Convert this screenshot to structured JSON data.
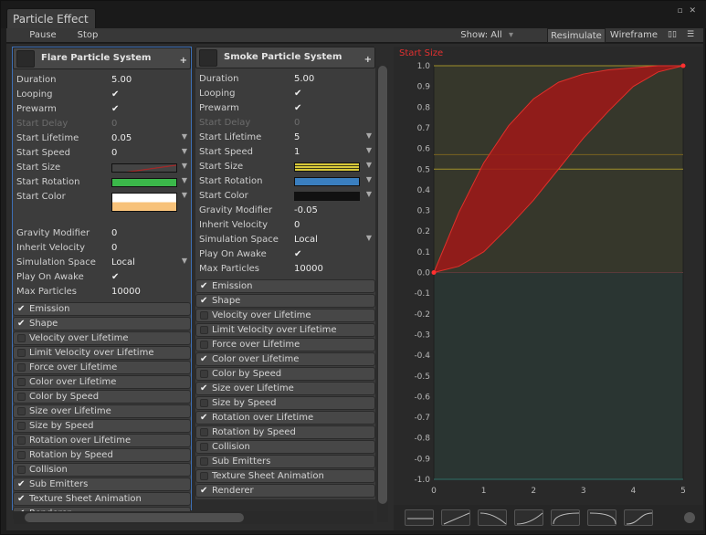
{
  "window": {
    "title": "Particle Effect"
  },
  "toolbar": {
    "pause": "Pause",
    "stop": "Stop",
    "show": "Show: All",
    "resimulate": "Resimulate",
    "wireframe": "Wireframe"
  },
  "panels": [
    {
      "title": "Flare Particle System",
      "props": [
        {
          "label": "Duration",
          "value": "5.00"
        },
        {
          "label": "Looping",
          "check": true
        },
        {
          "label": "Prewarm",
          "check": true
        },
        {
          "label": "Start Delay",
          "value": "0",
          "disabled": true
        },
        {
          "label": "Start Lifetime",
          "value": "0.05",
          "arrow": true
        },
        {
          "label": "Start Speed",
          "value": "0",
          "arrow": true
        },
        {
          "label": "Start Size",
          "curve": true,
          "arrow": true
        },
        {
          "label": "Start Rotation",
          "color": "#3bb84a",
          "arrow": true
        },
        {
          "label": "Start Color",
          "gradient": [
            "#ffffff",
            "#f7c27a"
          ],
          "arrow": true
        },
        {
          "gap": true
        },
        {
          "label": "Gravity Modifier",
          "value": "0"
        },
        {
          "label": "Inherit Velocity",
          "value": "0"
        },
        {
          "label": "Simulation Space",
          "value": "Local",
          "arrow": true
        },
        {
          "label": "Play On Awake",
          "check": true
        },
        {
          "label": "Max Particles",
          "value": "10000"
        }
      ],
      "modules": [
        {
          "label": "Emission",
          "on": true
        },
        {
          "label": "Shape",
          "on": true
        },
        {
          "label": "Velocity over Lifetime"
        },
        {
          "label": "Limit Velocity over Lifetime"
        },
        {
          "label": "Force over Lifetime"
        },
        {
          "label": "Color over Lifetime"
        },
        {
          "label": "Color by Speed"
        },
        {
          "label": "Size over Lifetime"
        },
        {
          "label": "Size by Speed"
        },
        {
          "label": "Rotation over Lifetime"
        },
        {
          "label": "Rotation by Speed"
        },
        {
          "label": "Collision"
        },
        {
          "label": "Sub Emitters",
          "on": true
        },
        {
          "label": "Texture Sheet Animation",
          "on": true
        },
        {
          "label": "Renderer",
          "on": true
        }
      ]
    },
    {
      "title": "Smoke Particle System",
      "props": [
        {
          "label": "Duration",
          "value": "5.00"
        },
        {
          "label": "Looping",
          "check": true
        },
        {
          "label": "Prewarm",
          "check": true
        },
        {
          "label": "Start Delay",
          "value": "0",
          "disabled": true
        },
        {
          "label": "Start Lifetime",
          "value": "5",
          "arrow": true
        },
        {
          "label": "Start Speed",
          "value": "1",
          "arrow": true
        },
        {
          "label": "Start Size",
          "color": "#d8c93a",
          "arrow": true
        },
        {
          "label": "Start Rotation",
          "color": "#3a7fc0",
          "arrow": true
        },
        {
          "label": "Start Color",
          "color": "#111111",
          "arrow": true
        },
        {
          "label": "Gravity Modifier",
          "value": "-0.05"
        },
        {
          "label": "Inherit Velocity",
          "value": "0"
        },
        {
          "label": "Simulation Space",
          "value": "Local",
          "arrow": true
        },
        {
          "label": "Play On Awake",
          "check": true
        },
        {
          "label": "Max Particles",
          "value": "10000"
        }
      ],
      "modules": [
        {
          "label": "Emission",
          "on": true
        },
        {
          "label": "Shape",
          "on": true
        },
        {
          "label": "Velocity over Lifetime"
        },
        {
          "label": "Limit Velocity over Lifetime"
        },
        {
          "label": "Force over Lifetime"
        },
        {
          "label": "Color over Lifetime",
          "on": true
        },
        {
          "label": "Color by Speed"
        },
        {
          "label": "Size over Lifetime",
          "on": true
        },
        {
          "label": "Size by Speed"
        },
        {
          "label": "Rotation over Lifetime",
          "on": true
        },
        {
          "label": "Rotation by Speed"
        },
        {
          "label": "Collision"
        },
        {
          "label": "Sub Emitters"
        },
        {
          "label": "Texture Sheet Animation"
        },
        {
          "label": "Renderer",
          "on": true
        }
      ]
    }
  ],
  "chart_data": {
    "type": "area",
    "title": "Start Size",
    "x_ticks": [
      "0",
      "1",
      "2",
      "3",
      "4",
      "5"
    ],
    "y_ticks": [
      "1.0",
      "0.9",
      "0.8",
      "0.7",
      "0.6",
      "0.5",
      "0.4",
      "0.3",
      "0.2",
      "0.1",
      "0.0",
      "-0.1",
      "-0.2",
      "-0.3",
      "-0.4",
      "-0.5",
      "-0.6",
      "-0.7",
      "-0.8",
      "-0.9",
      "-1.0"
    ],
    "xlim": [
      0,
      5
    ],
    "ylim": [
      -1,
      1
    ],
    "series": [
      {
        "x": [
          0,
          0.5,
          1,
          1.5,
          2,
          2.5,
          3,
          3.5,
          4,
          4.5,
          5
        ],
        "values": [
          0,
          0.29,
          0.53,
          0.71,
          0.84,
          0.92,
          0.96,
          0.98,
          0.99,
          1.0,
          1.0
        ]
      },
      {
        "x": [
          0,
          0.5,
          1,
          1.5,
          2,
          2.5,
          3,
          3.5,
          4,
          4.5,
          5
        ],
        "values": [
          0,
          0.03,
          0.1,
          0.22,
          0.35,
          0.5,
          0.65,
          0.78,
          0.9,
          0.97,
          1.0
        ]
      }
    ],
    "lines": [
      1.0,
      0.57,
      0.5
    ],
    "colors": {
      "fill": "#a01818",
      "stroke": "#e0302a",
      "line_top": "#a0902a",
      "line_mid": "#7a6420",
      "bg_pos": "#36372b",
      "bg_neg": "#2a3532"
    }
  }
}
